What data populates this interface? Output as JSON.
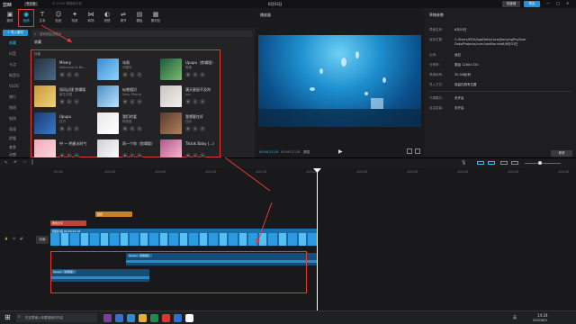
{
  "app": {
    "name": "剪映",
    "tag": "专业版",
    "subtitle": "IS 20:00 草稿转存到",
    "project": "6月03日",
    "btn_export": "导出",
    "btn_menu": "快捷键",
    "win_min": "—",
    "win_max": "□",
    "win_close": "✕"
  },
  "toolbar": {
    "items": [
      {
        "label": "媒体",
        "icon": "media-icon"
      },
      {
        "label": "音频",
        "icon": "audio-icon"
      },
      {
        "label": "文本",
        "icon": "text-icon"
      },
      {
        "label": "贴纸",
        "icon": "sticker-icon"
      },
      {
        "label": "特效",
        "icon": "effects-icon"
      },
      {
        "label": "转场",
        "icon": "transition-icon"
      },
      {
        "label": "滤镜",
        "icon": "filter-icon"
      },
      {
        "label": "调节",
        "icon": "adjust-icon"
      },
      {
        "label": "模板",
        "icon": "template-icon"
      },
      {
        "label": "素材包",
        "icon": "package-icon"
      }
    ]
  },
  "sidebar": {
    "import_btn": "+ 导入素材",
    "items": [
      "收藏",
      "抖音",
      "卡点",
      "纯音乐",
      "VLOG",
      "旅行",
      "悠闲",
      "轻快",
      "萌宠",
      "舒缓",
      "美食",
      "动感",
      "放松"
    ]
  },
  "library": {
    "search_placeholder": "搜索歌曲或歌手",
    "tab": "收藏",
    "section": "抖音",
    "cards": [
      {
        "name": "Misery",
        "artist": "Welcome to Be..."
      },
      {
        "name": "冰雨",
        "artist": "刘德华"
      },
      {
        "name": "Upupu（剪辑版）",
        "artist": "唯美"
      },
      {
        "name": "如风过境 剪辑版",
        "artist": "新生中国"
      },
      {
        "name": "似曾相识",
        "artist": "Sexy Zhong"
      },
      {
        "name": "满天星辰不及你",
        "artist": "ycc"
      },
      {
        "name": "Upupu",
        "artist": "匹刃"
      },
      {
        "name": "我们的爱",
        "artist": "阿悠悠"
      },
      {
        "name": "我想要在好",
        "artist": "四月"
      },
      {
        "name": "中 一 明星水时兮",
        "artist": ""
      },
      {
        "name": "再一个你（剪辑版）",
        "artist": ""
      },
      {
        "name": "Tiktok Baby (...)",
        "artist": ""
      }
    ]
  },
  "preview": {
    "title": "播放器",
    "time_current": "00:00:21:20",
    "time_total": "00:00:27:20",
    "quality": "原图",
    "play": "▶"
  },
  "props": {
    "title": "草稿参数",
    "rows": [
      {
        "k": "草稿名称：",
        "v": "6月03日"
      },
      {
        "k": "保存位置：",
        "v": "C:/Users/EDU/AppData/Local/JianyingPro/User Data/Projects/com.lveditor.draft/6月03日"
      },
      {
        "k": "比例：",
        "v": "适应"
      },
      {
        "k": "分辨率：",
        "v": "原始 1280×720"
      },
      {
        "k": "草稿帧率：",
        "v": "30.00帧/秒"
      },
      {
        "k": "导入方式：",
        "v": "保留在原有位置"
      },
      {
        "k": "代理模式：",
        "v": "未开启"
      },
      {
        "k": "自由层级：",
        "v": "未开启"
      }
    ],
    "edit_btn": "修改"
  },
  "timeline": {
    "ticks": [
      "00:00",
      "100:00",
      "100:05",
      "100:10",
      "100:15",
      "100:20",
      "100:25",
      "100:30",
      "100:35",
      "100:40",
      "100:45"
    ],
    "main_label": "封面",
    "clip_video": "视频片段 00:00:21:20",
    "clip_text": "黄色文字",
    "clip_sticker": "贴纸",
    "clip_audio1": "Upupu（剪辑版）",
    "clip_audio2": "Upupu（剪辑版）"
  },
  "taskbar": {
    "search": "在这里输入你要搜索的内容",
    "time": "14:24",
    "date": "2022/6/3",
    "lang": "英"
  }
}
